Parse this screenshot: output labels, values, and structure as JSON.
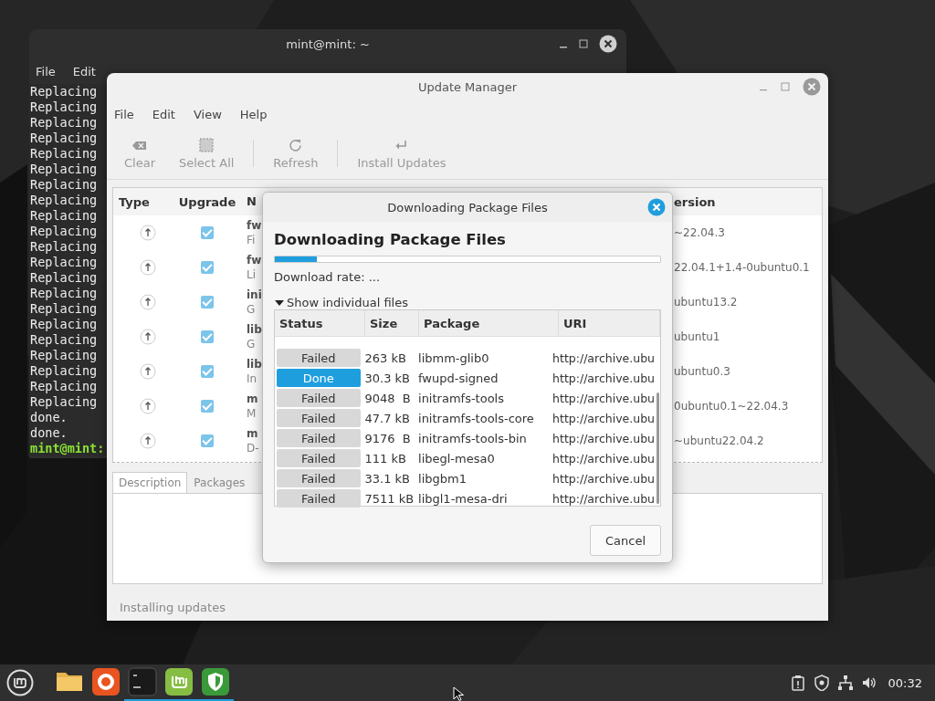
{
  "terminal": {
    "title": "mint@mint: ~",
    "menu": [
      "File",
      "Edit"
    ],
    "lines": [
      {
        "kind": "output",
        "text": "Replacing"
      },
      {
        "kind": "output",
        "text": "Replacing"
      },
      {
        "kind": "output",
        "text": "Replacing"
      },
      {
        "kind": "output",
        "text": "Replacing"
      },
      {
        "kind": "output",
        "text": "Replacing"
      },
      {
        "kind": "output",
        "text": "Replacing"
      },
      {
        "kind": "output",
        "text": "Replacing"
      },
      {
        "kind": "output",
        "text": "Replacing"
      },
      {
        "kind": "output",
        "text": "Replacing"
      },
      {
        "kind": "output",
        "text": "Replacing"
      },
      {
        "kind": "output",
        "text": "Replacing"
      },
      {
        "kind": "output",
        "text": "Replacing"
      },
      {
        "kind": "output",
        "text": "Replacing"
      },
      {
        "kind": "output",
        "text": "Replacing"
      },
      {
        "kind": "output",
        "text": "Replacing"
      },
      {
        "kind": "output",
        "text": "Replacing"
      },
      {
        "kind": "output",
        "text": "Replacing"
      },
      {
        "kind": "output",
        "text": "Replacing"
      },
      {
        "kind": "output",
        "text": "Replacing"
      },
      {
        "kind": "output",
        "text": "Replacing"
      },
      {
        "kind": "output",
        "text": "Replacing"
      },
      {
        "kind": "output",
        "text": "done."
      },
      {
        "kind": "output",
        "text": "done."
      },
      {
        "kind": "prompt",
        "text": "mint@mint:"
      }
    ]
  },
  "update_manager": {
    "title": "Update Manager",
    "menu": [
      "File",
      "Edit",
      "View",
      "Help"
    ],
    "toolbar": [
      {
        "kind": "clear",
        "label": "Clear",
        "disabled": true
      },
      {
        "kind": "select",
        "label": "Select All",
        "disabled": true
      },
      {
        "kind": "refresh",
        "label": "Refresh",
        "disabled": true
      },
      {
        "kind": "install",
        "label": "Install Updates",
        "disabled": true
      }
    ],
    "table": {
      "columns": [
        "Type",
        "Upgrade",
        "N",
        "ersion"
      ],
      "rows": [
        {
          "checked": true,
          "name": "fw",
          "description": "Fi",
          "version": "~22.04.3"
        },
        {
          "checked": true,
          "name": "fw",
          "description": "Li",
          "version": "22.04.1+1.4-0ubuntu0.1"
        },
        {
          "checked": true,
          "name": "ini",
          "description": "G",
          "version": "ubuntu13.2"
        },
        {
          "checked": true,
          "name": "lib",
          "description": "G",
          "version": "ubuntu1"
        },
        {
          "checked": true,
          "name": "lib",
          "description": "In",
          "version": "ubuntu0.3"
        },
        {
          "checked": true,
          "name": "m",
          "description": "M",
          "version": "0ubuntu0.1~22.04.3"
        },
        {
          "checked": true,
          "name": "m",
          "description": "D-",
          "version": "~ubuntu22.04.2"
        }
      ]
    },
    "tabs": [
      {
        "label": "Description",
        "selected": true
      },
      {
        "label": "Packages",
        "selected": false
      }
    ],
    "status_bar": "Installing updates"
  },
  "dialog": {
    "title": "Downloading Package Files",
    "heading": "Downloading Package Files",
    "progress": {
      "level": 0.11
    },
    "rate": "Download rate: ...",
    "expander": {
      "label": "Show individual files",
      "expanded": true
    },
    "columns": [
      "Status",
      "Size",
      "Package",
      "URI"
    ],
    "rows": [
      {
        "status": "Failed",
        "kind": "failed",
        "size": "263 kB",
        "package": "libmm-glib0",
        "uri": "http://archive.ubu"
      },
      {
        "status": "Done",
        "kind": "done",
        "size": "30.3 kB",
        "package": "fwupd-signed",
        "uri": "http://archive.ubu"
      },
      {
        "status": "Failed",
        "kind": "failed",
        "size": "9048  B",
        "package": "initramfs-tools",
        "uri": "http://archive.ubu"
      },
      {
        "status": "Failed",
        "kind": "failed",
        "size": "47.7 kB",
        "package": "initramfs-tools-core",
        "uri": "http://archive.ubu"
      },
      {
        "status": "Failed",
        "kind": "failed",
        "size": "9176  B",
        "package": "initramfs-tools-bin",
        "uri": "http://archive.ubu"
      },
      {
        "status": "Failed",
        "kind": "failed",
        "size": "111 kB",
        "package": "libegl-mesa0",
        "uri": "http://archive.ubu"
      },
      {
        "status": "Failed",
        "kind": "failed",
        "size": "33.1 kB",
        "package": "libgbm1",
        "uri": "http://archive.ubu"
      },
      {
        "status": "Failed",
        "kind": "failed",
        "size": "7511 kB",
        "package": "libgl1-mesa-dri",
        "uri": "http://archive.ubu"
      }
    ],
    "button": "Cancel"
  },
  "taskbar": {
    "launchers": [
      {
        "kind": "folder",
        "running": false
      },
      {
        "kind": "browser",
        "running": false
      },
      {
        "kind": "terminal",
        "running": true
      },
      {
        "kind": "mint",
        "running": true
      },
      {
        "kind": "shield",
        "running": true
      }
    ],
    "tray": [
      {
        "kind": "clipboard"
      },
      {
        "kind": "shield"
      },
      {
        "kind": "network"
      },
      {
        "kind": "volume"
      }
    ],
    "clock": "00:32"
  }
}
